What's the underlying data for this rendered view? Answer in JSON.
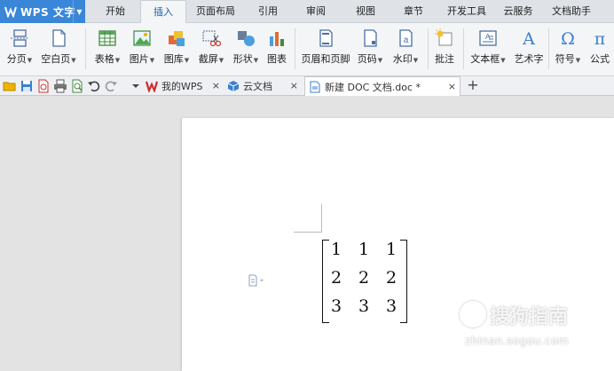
{
  "app": {
    "name": "WPS 文字",
    "brand_color": "#3a86d8"
  },
  "menu_tabs": [
    "开始",
    "插入",
    "页面布局",
    "引用",
    "审阅",
    "视图",
    "章节",
    "开发工具",
    "云服务",
    "文档助手"
  ],
  "active_menu_tab": "插入",
  "ribbon": {
    "page_break": "分页",
    "blank_page": "空白页",
    "table": "表格",
    "picture": "图片",
    "gallery": "图库",
    "screenshot": "截屏",
    "shapes": "形状",
    "chart": "图表",
    "header_footer": "页眉和页脚",
    "page_number": "页码",
    "watermark": "水印",
    "comment": "批注",
    "text_box": "文本框",
    "wordart": "艺术字",
    "symbol": "符号",
    "formula": "公式"
  },
  "doc_tabs": [
    {
      "label": "我的WPS"
    },
    {
      "label": "云文档"
    },
    {
      "label": "新建 DOC 文档.doc *"
    }
  ],
  "tab_close": "×",
  "new_tab": "+",
  "matrix": {
    "rows": [
      [
        "1",
        "1",
        "1"
      ],
      [
        "2",
        "2",
        "2"
      ],
      [
        "3",
        "3",
        "3"
      ]
    ]
  },
  "watermark": {
    "text": "搜狗指南",
    "url": "zhinan.sogou.com"
  }
}
